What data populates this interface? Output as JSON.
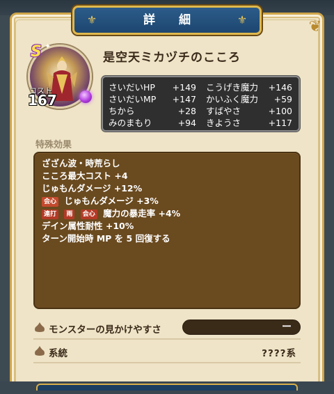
{
  "header": {
    "title": "詳 細"
  },
  "monster": {
    "rank": "S",
    "cost_label": "コスト",
    "cost": "167",
    "name": "是空天ミカヅチのこころ"
  },
  "stats": [
    {
      "name": "さいだいHP",
      "value": "+149"
    },
    {
      "name": "こうげき魔力",
      "value": "+146"
    },
    {
      "name": "さいだいMP",
      "value": "+147"
    },
    {
      "name": "かいふく魔力",
      "value": "+59"
    },
    {
      "name": "ちから",
      "value": "+28"
    },
    {
      "name": "すばやさ",
      "value": "+100"
    },
    {
      "name": "みのまもり",
      "value": "+94"
    },
    {
      "name": "きようさ",
      "value": "+117"
    }
  ],
  "effects": {
    "title": "特殊効果",
    "lines": [
      {
        "tags": [],
        "text": "ざざん波・時荒らし"
      },
      {
        "tags": [],
        "text": "こころ最大コスト +4"
      },
      {
        "tags": [],
        "text": "じゅもんダメージ +12%"
      },
      {
        "tags": [
          "会心"
        ],
        "text": "じゅもんダメージ +3%"
      },
      {
        "tags": [
          "連打",
          "雨",
          "会心"
        ],
        "text": "魔力の暴走率 +4%"
      },
      {
        "tags": [],
        "text": "デイン属性耐性 +10%"
      },
      {
        "tags": [],
        "text": "ターン開始時 MP を 5 回復する"
      }
    ]
  },
  "visibility": {
    "label": "モンスターの見かけやすさ",
    "value": "ー"
  },
  "lineage": {
    "label": "系統",
    "value": "????系"
  },
  "colors": {
    "panel": "#efe4c7",
    "gold": "#cfa64a",
    "header_blue": "#1d4670",
    "effects_bg": "#6a4a1f",
    "stats_bg": "#2f2f2f"
  },
  "icons": {
    "header_left": "fleur-de-lis-icon",
    "header_right": "fleur-de-lis-icon",
    "row_icon": "slime-drop-icon"
  }
}
